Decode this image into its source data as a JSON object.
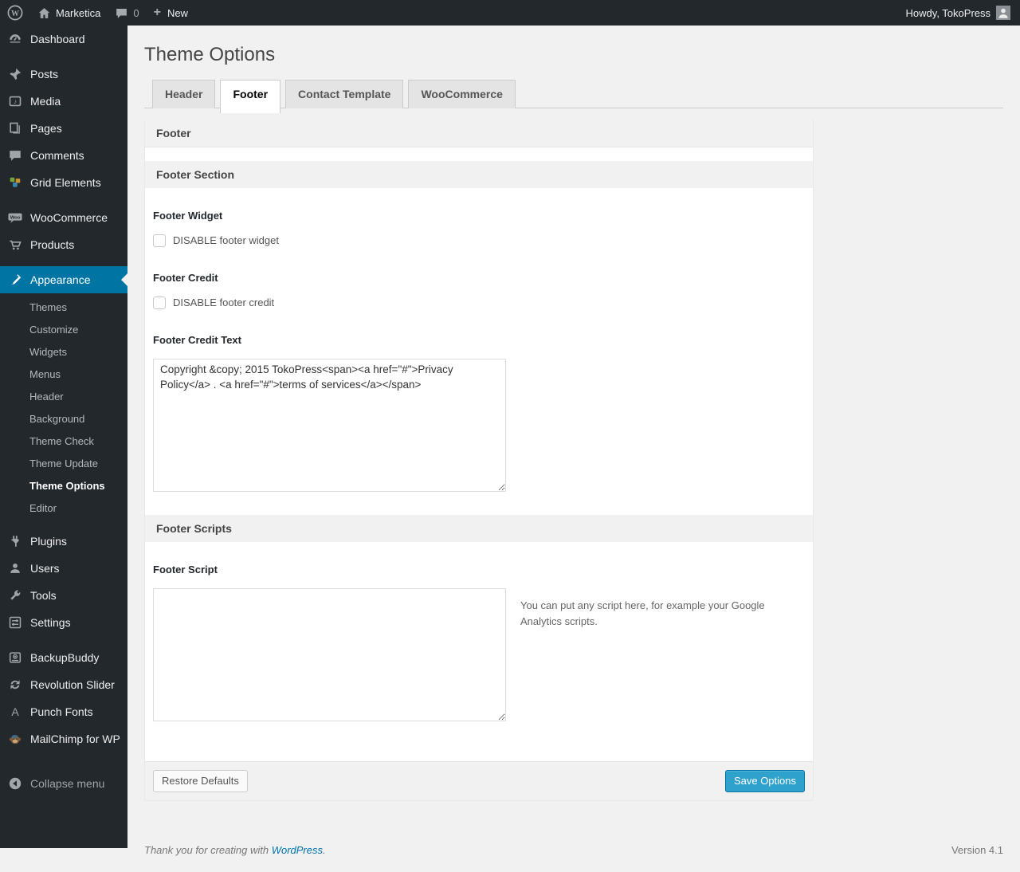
{
  "admin_bar": {
    "site_name": "Marketica",
    "comment_count": "0",
    "new_label": "New",
    "howdy_text": "Howdy, TokoPress"
  },
  "sidebar": {
    "top_items": [
      {
        "label": "Dashboard"
      },
      {
        "label": "Posts"
      },
      {
        "label": "Media"
      },
      {
        "label": "Pages"
      },
      {
        "label": "Comments"
      },
      {
        "label": "Grid Elements"
      },
      {
        "label": "WooCommerce"
      },
      {
        "label": "Products"
      }
    ],
    "appearance": {
      "label": "Appearance",
      "submenu": [
        {
          "label": "Themes"
        },
        {
          "label": "Customize"
        },
        {
          "label": "Widgets"
        },
        {
          "label": "Menus"
        },
        {
          "label": "Header"
        },
        {
          "label": "Background"
        },
        {
          "label": "Theme Check"
        },
        {
          "label": "Theme Update"
        },
        {
          "label": "Theme Options"
        },
        {
          "label": "Editor"
        }
      ],
      "current_submenu": "Theme Options"
    },
    "bottom_items": [
      {
        "label": "Plugins"
      },
      {
        "label": "Users"
      },
      {
        "label": "Tools"
      },
      {
        "label": "Settings"
      },
      {
        "label": "BackupBuddy"
      },
      {
        "label": "Revolution Slider"
      },
      {
        "label": "Punch Fonts"
      },
      {
        "label": "MailChimp for WP"
      }
    ],
    "collapse_label": "Collapse menu"
  },
  "page": {
    "title": "Theme Options",
    "tabs": [
      {
        "label": "Header"
      },
      {
        "label": "Footer"
      },
      {
        "label": "Contact Template"
      },
      {
        "label": "WooCommerce"
      }
    ],
    "active_tab": "Footer"
  },
  "panel": {
    "box_title": "Footer",
    "section1": {
      "title": "Footer Section",
      "footer_widget_label": "Footer Widget",
      "footer_widget_checkbox": "DISABLE footer widget",
      "footer_widget_checked": false,
      "footer_credit_label": "Footer Credit",
      "footer_credit_checkbox": "DISABLE footer credit",
      "footer_credit_checked": false,
      "footer_credit_text_label": "Footer Credit Text",
      "footer_credit_text_value": "Copyright &copy; 2015 TokoPress<span><a href=\"#\">Privacy Policy</a> . <a href=\"#\">terms of services</a></span>"
    },
    "section2": {
      "title": "Footer Scripts",
      "footer_script_label": "Footer Script",
      "footer_script_value": "",
      "footer_script_help": "You can put any script here, for example your Google Analytics scripts."
    },
    "buttons": {
      "restore": "Restore Defaults",
      "save": "Save Options"
    }
  },
  "footer": {
    "thanks_prefix": "Thank you for creating with ",
    "wordpress_link": "WordPress",
    "thanks_suffix": ".",
    "version": "Version 4.1"
  },
  "colors": {
    "menu_highlight": "#0074a2",
    "primary_button": "#2ea2cc",
    "link_blue": "#0073aa",
    "admin_bar_bg": "#23282d"
  }
}
